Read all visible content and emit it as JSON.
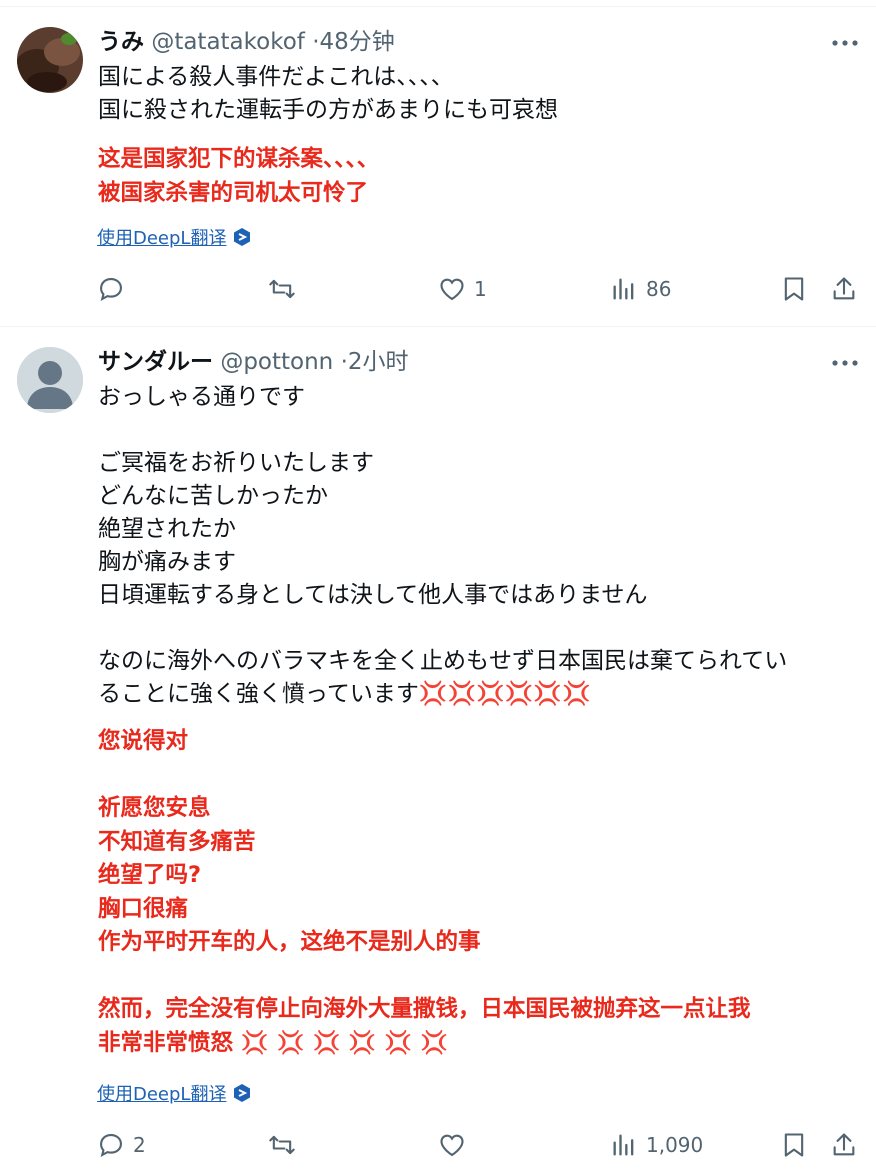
{
  "tweets": [
    {
      "display_name": "うみ",
      "handle": "@tatatakokof",
      "separator": "·",
      "time": "48分钟",
      "text_lines": [
        "国による殺人事件だよこれは、、、、",
        "国に殺された運転手の方があまりにも可哀想"
      ],
      "translation_lines": [
        "这是国家犯下的谋杀案、、、、",
        "被国家杀害的司机太可怜了"
      ],
      "deepl_label": "使用DeepL翻译",
      "replies": "",
      "retweets": "",
      "likes": "1",
      "views": "86"
    },
    {
      "display_name": "サンダルー",
      "handle": "@pottonn",
      "separator": "·",
      "time": "2小时",
      "text_lines": [
        "おっしゃる通りです",
        "",
        "ご冥福をお祈りいたします",
        "どんなに苦しかったか",
        "絶望されたか",
        "胸が痛みます",
        "日頃運転する身としては決して他人事ではありません",
        "",
        "なのに海外へのバラマキを全く止めもせず日本国民は棄てられてい",
        "ることに強く強く憤っています"
      ],
      "anger_emoji": "💢💢💢💢💢💢",
      "translation_lines": [
        "您说得对",
        "",
        "祈愿您安息",
        "不知道有多痛苦",
        "绝望了吗?",
        "胸口很痛",
        "作为平时开车的人，这绝不是别人的事",
        "",
        "然而，完全没有停止向海外大量撒钱，日本国民被抛弃这一点让我",
        "非常非常愤怒"
      ],
      "translation_anger": "💢 💢 💢 💢 💢 💢",
      "deepl_label": "使用DeepL翻译",
      "replies": "2",
      "retweets": "",
      "likes": "",
      "views": "1,090"
    }
  ],
  "colors": {
    "text": "#0f1419",
    "secondary": "#536471",
    "translation": "#e8291c",
    "link": "#1d62b4",
    "divider": "#eff3f4"
  },
  "icons": [
    "more-icon",
    "reply-icon",
    "retweet-icon",
    "like-icon",
    "views-icon",
    "bookmark-icon",
    "share-icon",
    "deepl-icon"
  ]
}
